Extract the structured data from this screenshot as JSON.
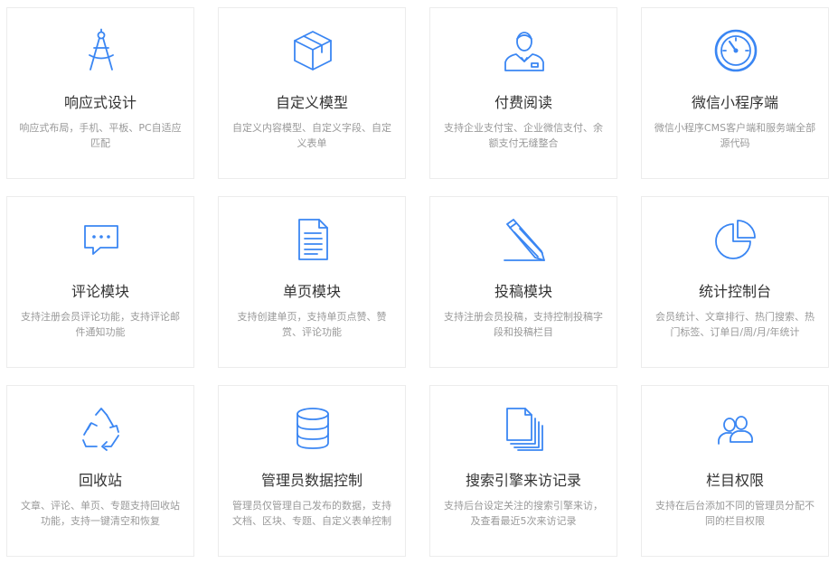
{
  "accent_color": "#3a86f3",
  "features": [
    {
      "icon": "compass-icon",
      "title": "响应式设计",
      "desc": "响应式布局，手机、平板、PC自适应匹配"
    },
    {
      "icon": "box-icon",
      "title": "自定义模型",
      "desc": "自定义内容模型、自定义字段、自定义表单"
    },
    {
      "icon": "user-tie-icon",
      "title": "付费阅读",
      "desc": "支持企业支付宝、企业微信支付、余额支付无缝整合"
    },
    {
      "icon": "gauge-icon",
      "title": "微信小程序端",
      "desc": "微信小程序CMS客户端和服务端全部源代码"
    },
    {
      "icon": "chat-bubble-icon",
      "title": "评论模块",
      "desc": "支持注册会员评论功能，支持评论邮件通知功能"
    },
    {
      "icon": "document-icon",
      "title": "单页模块",
      "desc": "支持创建单页，支持单页点赞、赞赏、评论功能"
    },
    {
      "icon": "pencil-icon",
      "title": "投稿模块",
      "desc": "支持注册会员投稿，支持控制投稿字段和投稿栏目"
    },
    {
      "icon": "pie-chart-icon",
      "title": "统计控制台",
      "desc": "会员统计、文章排行、热门搜索、热门标签、订单日/周/月/年统计"
    },
    {
      "icon": "recycle-icon",
      "title": "回收站",
      "desc": "文章、评论、单页、专题支持回收站功能，支持一键清空和恢复"
    },
    {
      "icon": "database-icon",
      "title": "管理员数据控制",
      "desc": "管理员仅管理自己发布的数据，支持文档、区块、专题、自定义表单控制"
    },
    {
      "icon": "files-icon",
      "title": "搜索引擎来访记录",
      "desc": "支持后台设定关注的搜索引擎来访，及查看最近5次来访记录"
    },
    {
      "icon": "users-icon",
      "title": "栏目权限",
      "desc": "支持在后台添加不同的管理员分配不同的栏目权限"
    }
  ]
}
